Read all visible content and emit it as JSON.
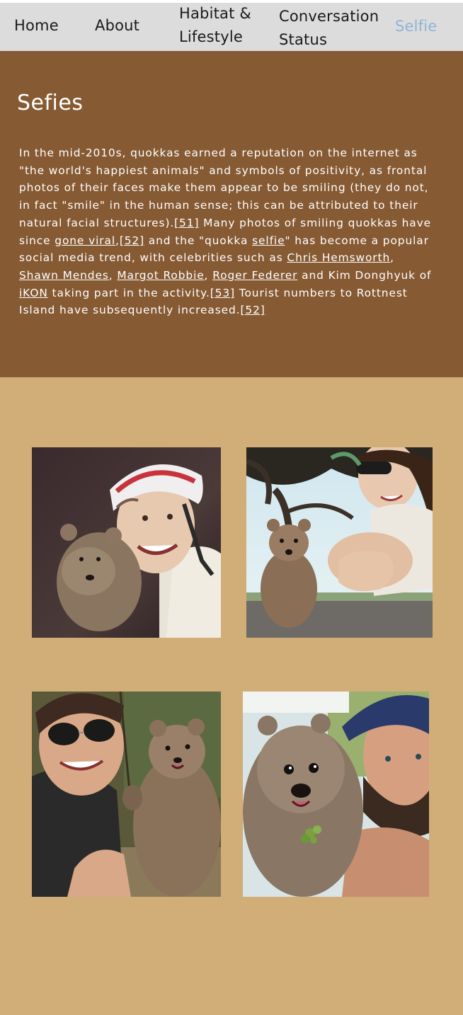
{
  "nav": {
    "home": "Home",
    "about": "About",
    "habitat_line1": "Habitat &",
    "habitat_line2": "Lifestyle",
    "conversation_line1": "Conversation",
    "conversation_line2": "Status",
    "selfie": "Selfie"
  },
  "hero": {
    "title": "Sefies",
    "paragraph": {
      "t1": "In the mid-2010s, quokkas earned a reputation on the internet as \"the world's happiest animals\" and symbols of positivity, as frontal photos of their faces make them appear to be smiling (they do not, in fact \"smile\" in the human sense; this can be attributed to their natural facial structures).",
      "ref51": "[51]",
      "t2": " Many photos of smiling quokkas have since ",
      "link_viral": "gone viral",
      "t3": ",",
      "ref52a": "[52]",
      "t4": " and the \"quokka ",
      "link_selfie": "selfie",
      "t5": "\" has become a popular social media trend, with celebrities such as ",
      "link_hemsworth": "Chris Hemsworth",
      "t6": ", ",
      "link_mendes": "Shawn Mendes",
      "t7": ", ",
      "link_robbie": "Margot Robbie",
      "t8": ", ",
      "link_federer": "Roger Federer",
      "t9": " and Kim Donghyuk of ",
      "link_ikon": "iKON",
      "t10": " taking part in the activity.",
      "ref53": "[53]",
      "t11": " Tourist numbers to Rottnest Island have subsequently increased.",
      "ref52b": "[52]"
    }
  },
  "gallery": {
    "photos": [
      {
        "name": "quokka-selfie-cyclist"
      },
      {
        "name": "quokka-selfie-woman-sunglasses-tree"
      },
      {
        "name": "quokka-selfie-woman-lying"
      },
      {
        "name": "quokka-selfie-man-cap"
      }
    ]
  },
  "colors": {
    "nav_bg": "#dcdcdc",
    "nav_active": "#8fb4d8",
    "hero_bg": "#865a33",
    "page_bg": "#d1ad78"
  }
}
